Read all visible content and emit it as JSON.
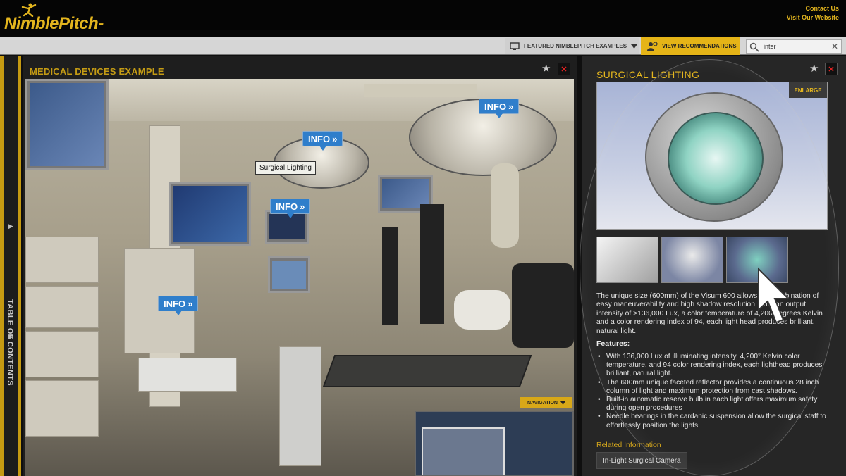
{
  "header": {
    "logo_text": "NimblePitch",
    "links": [
      "Contact Us",
      "Visit Our Website"
    ]
  },
  "toolbar": {
    "featured_label": "FEATURED NIMBLEPITCH EXAMPLES",
    "recommend_label": "VIEW RECOMMENDATIONS",
    "search_value": "inter"
  },
  "toc": {
    "label": "TABLE OF CONTENTS"
  },
  "left_panel": {
    "title": "MEDICAL DEVICES EXAMPLE",
    "hotspots": [
      "INFO",
      "INFO",
      "INFO",
      "INFO"
    ],
    "callout": "Surgical Lighting",
    "navigation_label": "NAVIGATION"
  },
  "right_panel": {
    "title": "SURGICAL LIGHTING",
    "enlarge_label": "ENLARGE",
    "description": "The unique size (600mm) of the Visum 600 allows the combination of easy maneuverability and high shadow resolution. With an output intensity of >136,000 Lux, a color temperature of 4,200 degrees Kelvin and a color rendering index of 94, each light head produces brilliant, natural light.",
    "features_heading": "Features:",
    "features": [
      "With 136,000 Lux of illuminating intensity, 4,200° Kelvin color temperature, and 94 color rendering index, each lighthead produces brilliant, natural light.",
      "The 600mm unique faceted reflector provides a continuous 28 inch column of light and maximum protection from cast shadows.",
      "Built-in automatic reserve bulb in each light offers maximum safety during open procedures",
      "Needle bearings in the cardanic suspension allow the surgical staff to effortlessly position the lights"
    ],
    "related_heading": "Related Information",
    "related_link": "In-Light Surgical Camera"
  },
  "colors": {
    "brand_gold": "#e3b51e",
    "info_blue": "#2f7ecb",
    "close_red": "#d22222"
  }
}
